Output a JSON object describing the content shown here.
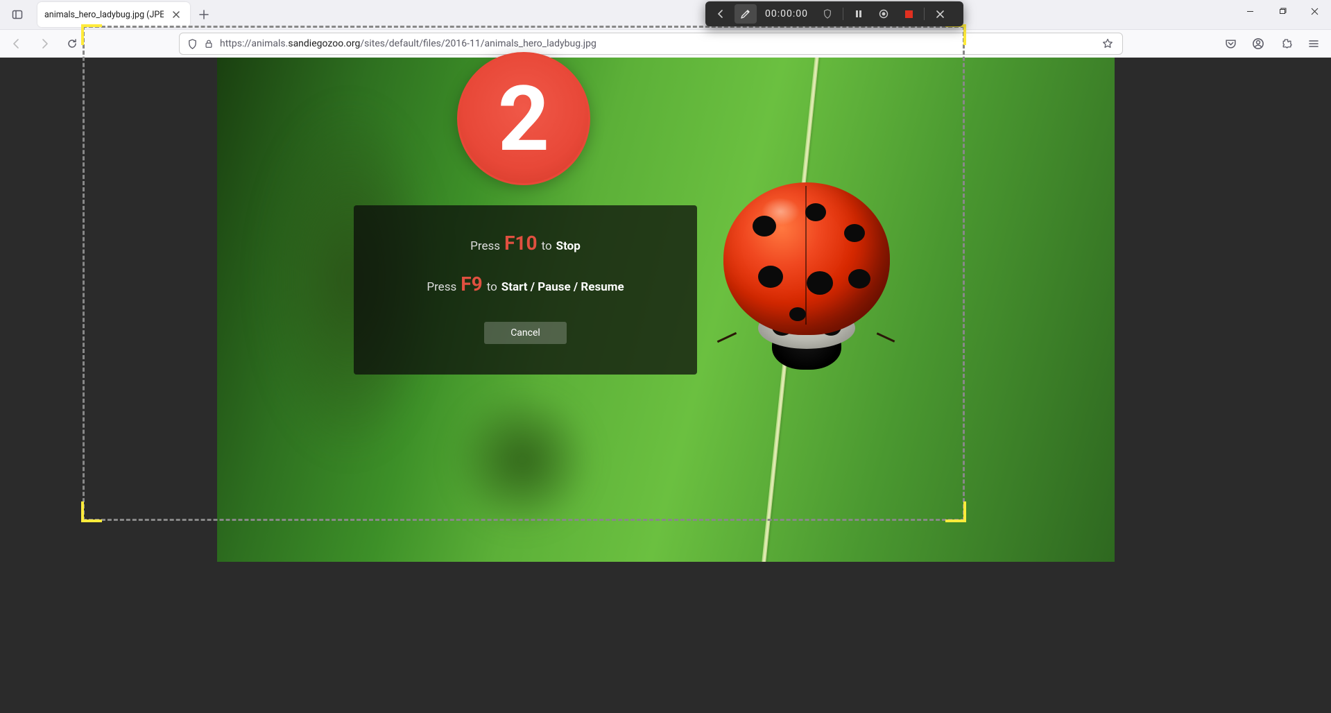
{
  "browser": {
    "tab_title": "animals_hero_ladybug.jpg (JPEG Im",
    "url_prefix": "https://animals.",
    "url_domain": "sandiegozoo.org",
    "url_path": "/sites/default/files/2016-11/animals_hero_ladybug.jpg"
  },
  "recorder": {
    "time": "00:00:00",
    "countdown": "2"
  },
  "hotkeys": {
    "press": "Press",
    "to": "to",
    "stop_key": "F10",
    "stop_action": "Stop",
    "start_key": "F9",
    "start_action": "Start / Pause / Resume",
    "cancel": "Cancel"
  },
  "colors": {
    "accent_red": "#e84838",
    "selection_yellow": "#ffeb3b"
  }
}
